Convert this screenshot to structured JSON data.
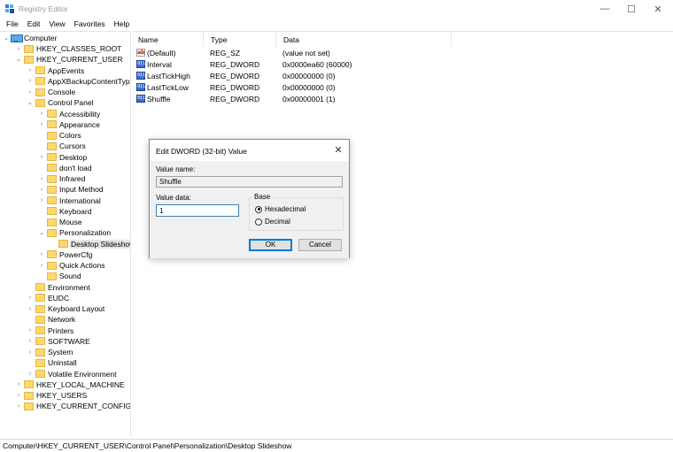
{
  "window": {
    "title": "Registry Editor",
    "minimize_glyph": "—",
    "maximize_glyph": "☐",
    "close_glyph": "✕"
  },
  "menu": [
    "File",
    "Edit",
    "View",
    "Favorites",
    "Help"
  ],
  "tree": {
    "root": "Computer",
    "items": [
      {
        "label": "HKEY_CLASSES_ROOT",
        "expander": "›",
        "name": "tree-item-hkey-classes-root"
      },
      {
        "label": "HKEY_CURRENT_USER",
        "expander": "⌄",
        "name": "tree-item-hkey-current-user"
      },
      {
        "label": "AppEvents",
        "expander": "›",
        "name": "tree-item-appevents"
      },
      {
        "label": "AppXBackupContentType",
        "expander": "›",
        "name": "tree-item-appxbackupcontenttype"
      },
      {
        "label": "Console",
        "expander": "›",
        "name": "tree-item-console"
      },
      {
        "label": "Control Panel",
        "expander": "⌄",
        "name": "tree-item-control-panel"
      },
      {
        "label": "Accessibility",
        "expander": "›",
        "name": "tree-item-accessibility"
      },
      {
        "label": "Appearance",
        "expander": "›",
        "name": "tree-item-appearance"
      },
      {
        "label": "Colors",
        "expander": "",
        "name": "tree-item-colors"
      },
      {
        "label": "Cursors",
        "expander": "",
        "name": "tree-item-cursors"
      },
      {
        "label": "Desktop",
        "expander": "›",
        "name": "tree-item-desktop"
      },
      {
        "label": "don't load",
        "expander": "",
        "name": "tree-item-dont-load"
      },
      {
        "label": "Infrared",
        "expander": "›",
        "name": "tree-item-infrared"
      },
      {
        "label": "Input Method",
        "expander": "›",
        "name": "tree-item-input-method"
      },
      {
        "label": "International",
        "expander": "›",
        "name": "tree-item-international"
      },
      {
        "label": "Keyboard",
        "expander": "",
        "name": "tree-item-keyboard"
      },
      {
        "label": "Mouse",
        "expander": "",
        "name": "tree-item-mouse"
      },
      {
        "label": "Personalization",
        "expander": "⌄",
        "name": "tree-item-personalization"
      },
      {
        "label": "Desktop Slideshow",
        "expander": "",
        "name": "tree-item-desktop-slideshow"
      },
      {
        "label": "PowerCfg",
        "expander": "›",
        "name": "tree-item-powercfg"
      },
      {
        "label": "Quick Actions",
        "expander": "›",
        "name": "tree-item-quick-actions"
      },
      {
        "label": "Sound",
        "expander": "",
        "name": "tree-item-sound"
      },
      {
        "label": "Environment",
        "expander": "",
        "name": "tree-item-environment"
      },
      {
        "label": "EUDC",
        "expander": "›",
        "name": "tree-item-eudc"
      },
      {
        "label": "Keyboard Layout",
        "expander": "›",
        "name": "tree-item-keyboard-layout"
      },
      {
        "label": "Network",
        "expander": "",
        "name": "tree-item-network"
      },
      {
        "label": "Printers",
        "expander": "›",
        "name": "tree-item-printers"
      },
      {
        "label": "SOFTWARE",
        "expander": "›",
        "name": "tree-item-software"
      },
      {
        "label": "System",
        "expander": "›",
        "name": "tree-item-system"
      },
      {
        "label": "Uninstall",
        "expander": "",
        "name": "tree-item-uninstall"
      },
      {
        "label": "Volatile Environment",
        "expander": "›",
        "name": "tree-item-volatile-environment"
      },
      {
        "label": "HKEY_LOCAL_MACHINE",
        "expander": "›",
        "name": "tree-item-hkey-local-machine"
      },
      {
        "label": "HKEY_USERS",
        "expander": "›",
        "name": "tree-item-hkey-users"
      },
      {
        "label": "HKEY_CURRENT_CONFIG",
        "expander": "›",
        "name": "tree-item-hkey-current-config"
      }
    ]
  },
  "list": {
    "columns": [
      "Name",
      "Type",
      "Data"
    ],
    "rows": [
      {
        "icon": "string-value-icon",
        "name": "(Default)",
        "type": "REG_SZ",
        "data": "(value not set)"
      },
      {
        "icon": "dword-value-icon",
        "name": "Interval",
        "type": "REG_DWORD",
        "data": "0x0000ea60 (60000)"
      },
      {
        "icon": "dword-value-icon",
        "name": "LastTickHigh",
        "type": "REG_DWORD",
        "data": "0x00000000 (0)"
      },
      {
        "icon": "dword-value-icon",
        "name": "LastTickLow",
        "type": "REG_DWORD",
        "data": "0x00000000 (0)"
      },
      {
        "icon": "dword-value-icon",
        "name": "Shuffle",
        "type": "REG_DWORD",
        "data": "0x00000001 (1)"
      }
    ]
  },
  "dialog": {
    "title": "Edit DWORD (32-bit) Value",
    "value_name_label": "Value name:",
    "value_name": "Shuffle",
    "value_data_label": "Value data:",
    "value_data": "1",
    "base_label": "Base",
    "hex_label": "Hexadecimal",
    "dec_label": "Decimal",
    "selected_base": "Hexadecimal",
    "ok_label": "OK",
    "cancel_label": "Cancel"
  },
  "statusbar": {
    "path": "Computer\\HKEY_CURRENT_USER\\Control Panel\\Personalization\\Desktop Slideshow"
  },
  "colors": {
    "accent": "#0078d7",
    "folder": "#fcd96a",
    "selection": "#e5e5e5"
  }
}
